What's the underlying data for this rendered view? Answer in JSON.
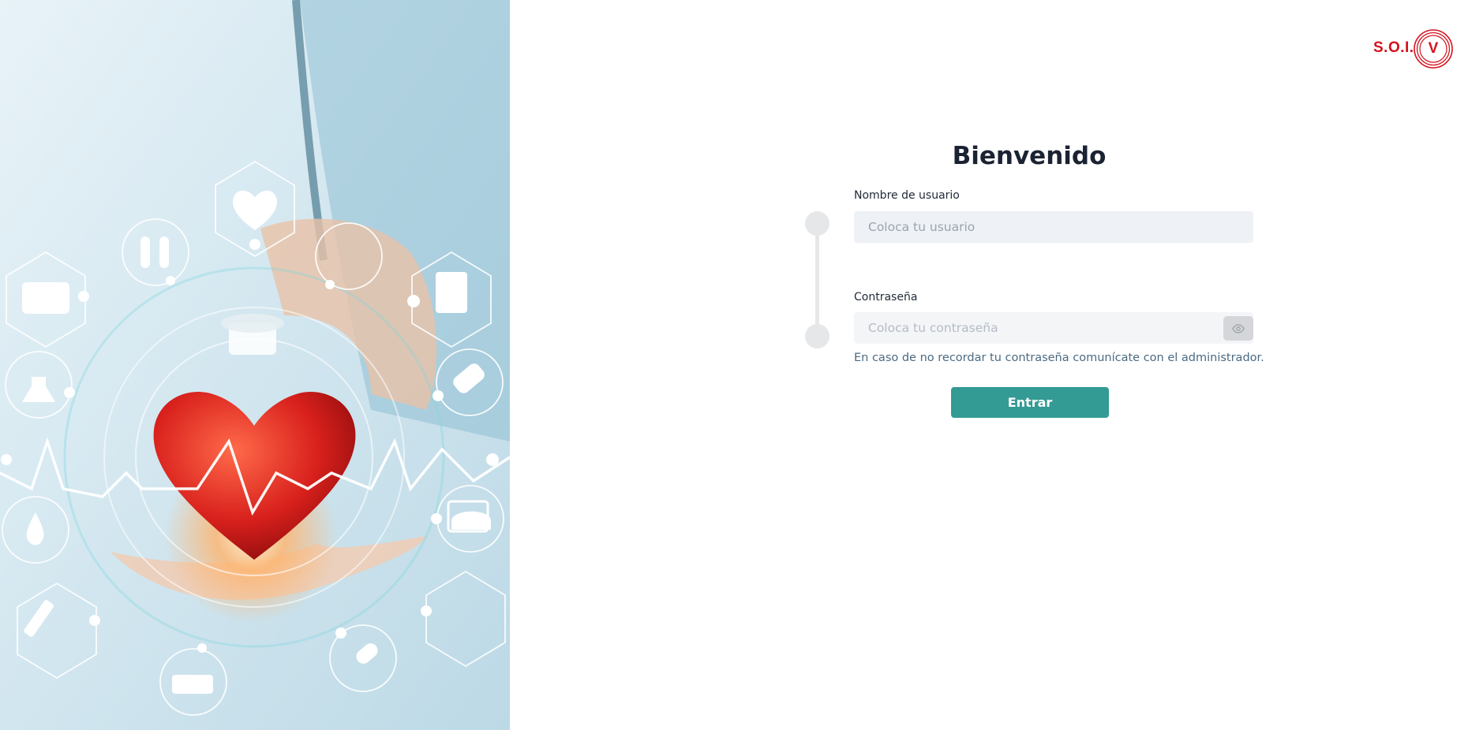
{
  "hero": {
    "description_icons": [
      "heart-pulse-icon",
      "test-tubes-icon",
      "first-aid-kit-icon",
      "dropper-icon",
      "clipboard-icon",
      "flask-icon",
      "pills-icon",
      "drop-icon",
      "nurse-cap-icon",
      "syringe-icon",
      "monitor-icon",
      "capsules-icon",
      "ambulance-icon"
    ]
  },
  "logo": {
    "text": "S.O.I.",
    "letter": "V",
    "color": "#d4121e"
  },
  "form": {
    "title": "Bienvenido",
    "username": {
      "label": "Nombre de usuario",
      "placeholder": "Coloca tu usuario",
      "value": ""
    },
    "password": {
      "label": "Contraseña",
      "placeholder": "Coloca tu contraseña",
      "value": ""
    },
    "hint": "En caso de no recordar tu contraseña comunícate con el administrador.",
    "submit_label": "Entrar",
    "accent_color": "#339a94"
  }
}
